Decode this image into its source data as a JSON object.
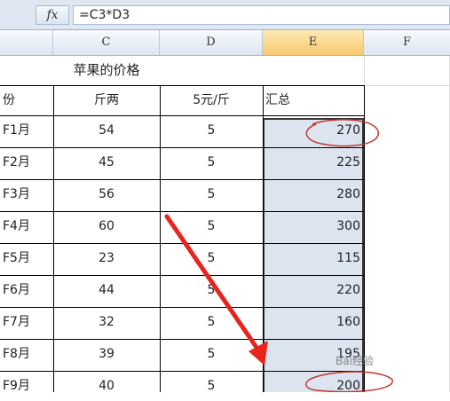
{
  "formula_bar": {
    "fx_label": "fx",
    "formula": "=C3*D3"
  },
  "columns": [
    {
      "id": "B",
      "label": ""
    },
    {
      "id": "C",
      "label": "C"
    },
    {
      "id": "D",
      "label": "D"
    },
    {
      "id": "E",
      "label": "E"
    },
    {
      "id": "F",
      "label": "F"
    }
  ],
  "sheet": {
    "title": "苹果的价格",
    "headers": {
      "month": "份",
      "weight": "斤两",
      "price": "5元/斤",
      "total": "汇总"
    },
    "rows": [
      {
        "month": "F1月",
        "weight": "54",
        "price": "5",
        "total": "270"
      },
      {
        "month": "F2月",
        "weight": "45",
        "price": "5",
        "total": "225"
      },
      {
        "month": "F3月",
        "weight": "56",
        "price": "5",
        "total": "280"
      },
      {
        "month": "F4月",
        "weight": "60",
        "price": "5",
        "total": "300"
      },
      {
        "month": "F5月",
        "weight": "23",
        "price": "5",
        "total": "115"
      },
      {
        "month": "F6月",
        "weight": "44",
        "price": "5",
        "total": "220"
      },
      {
        "month": "F7月",
        "weight": "32",
        "price": "5",
        "total": "160"
      },
      {
        "month": "F8月",
        "weight": "39",
        "price": "5",
        "total": "195"
      },
      {
        "month": "F9月",
        "weight": "40",
        "price": "5",
        "total": "200"
      }
    ]
  },
  "annotations": {
    "arrow_color": "#e8241c",
    "circle_color": "#c0392b"
  },
  "watermark": "Bai经验"
}
